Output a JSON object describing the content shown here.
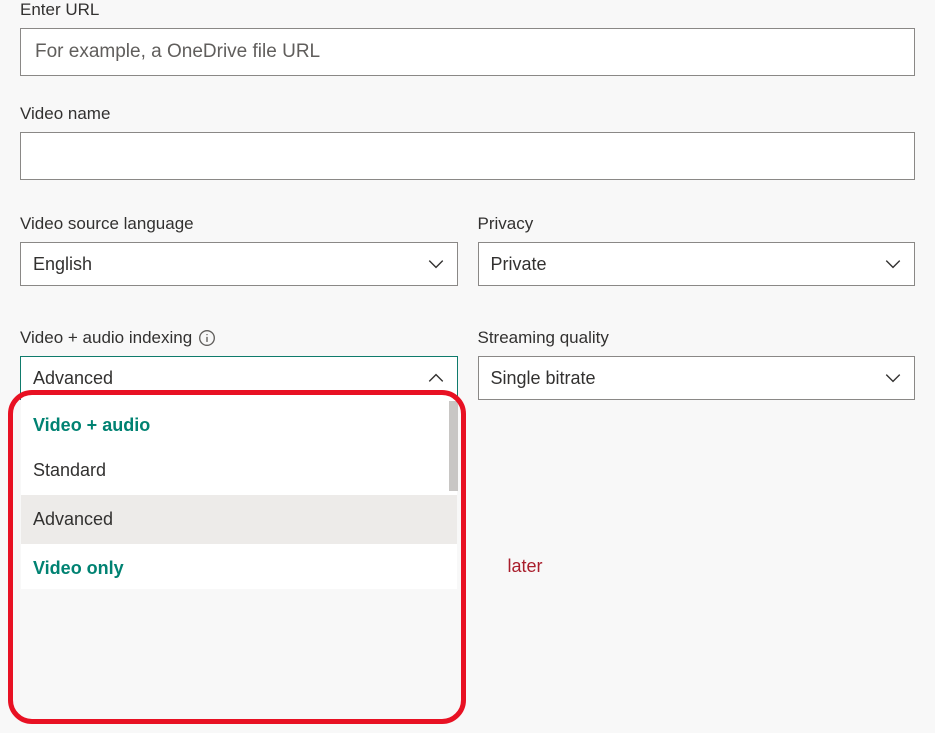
{
  "url_field": {
    "label": "Enter URL",
    "placeholder": "For example, a OneDrive file URL",
    "value": ""
  },
  "video_name": {
    "label": "Video name",
    "value": ""
  },
  "language": {
    "label": "Video source language",
    "selected": "English"
  },
  "privacy": {
    "label": "Privacy",
    "selected": "Private"
  },
  "indexing": {
    "label": "Video + audio indexing",
    "selected": "Advanced",
    "dropdown": {
      "group1_header": "Video + audio",
      "option_standard": "Standard",
      "option_advanced": "Advanced",
      "group2_header": "Video only"
    }
  },
  "streaming": {
    "label": "Streaming quality",
    "selected": "Single bitrate"
  },
  "partial_text": "later"
}
